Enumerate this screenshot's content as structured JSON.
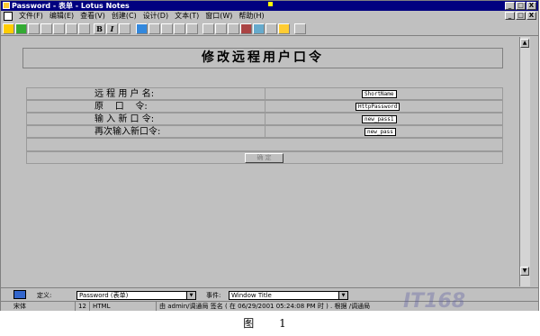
{
  "window": {
    "title": "Password - 表单 - Lotus Notes",
    "controls": [
      "_",
      "□",
      "X"
    ],
    "doc_controls": [
      "_",
      "□",
      "X"
    ]
  },
  "menu": [
    "文件(F)",
    "编辑(E)",
    "查看(V)",
    "创建(C)",
    "设计(D)",
    "文本(T)",
    "窗口(W)",
    "帮助(H)"
  ],
  "toolbar": {
    "bold": "B",
    "italic": "I"
  },
  "form": {
    "heading": "修改远程用户口令",
    "rows": [
      {
        "label": "远 程 用 户 名:",
        "field": "ShortName"
      },
      {
        "label": "原    口    令:",
        "field": "HttpPassword"
      },
      {
        "label": "输 入 新 口 令:",
        "field": "new_pass1"
      },
      {
        "label": "再次输入新口令:",
        "field": "new_pass"
      }
    ],
    "submit_label": "确 定"
  },
  "design": {
    "define_label": "定义:",
    "define_value": "Password (表单)",
    "event_label": "事件:",
    "event_value": "Window Title"
  },
  "status": {
    "font": "宋体",
    "size": "12",
    "type": "HTML",
    "message": "由 admin/调通局 签名 ( 在 06/29/2001 05:24:08 PM 时 ) . 根据 /调通局"
  },
  "watermark": "IT168",
  "caption": "图 1"
}
